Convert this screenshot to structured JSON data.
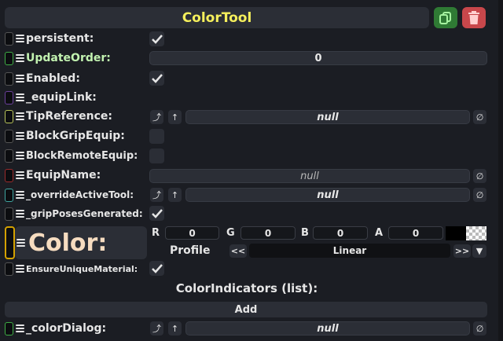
{
  "header": {
    "title": "ColorTool",
    "duplicate_icon": "duplicate-icon",
    "delete_icon": "trash-icon"
  },
  "fields": {
    "persistent": {
      "label": "persistent:"
    },
    "update_order": {
      "label": "UpdateOrder:",
      "value": "0"
    },
    "enabled": {
      "label": "Enabled:"
    },
    "equip_link": {
      "label": "_equipLink:"
    },
    "tip_reference": {
      "label": "TipReference:",
      "value": "null"
    },
    "block_grip_equip": {
      "label": "BlockGripEquip:"
    },
    "block_remote_equip": {
      "label": "BlockRemoteEquip:"
    },
    "equip_name": {
      "label": "EquipName:",
      "value": "null"
    },
    "override_active_tool": {
      "label": "_overrideActiveTool:",
      "value": "null"
    },
    "grip_poses_generated": {
      "label": "_gripPosesGenerated:"
    },
    "color": {
      "label": "Color:",
      "r_label": "R",
      "r": "0",
      "g_label": "G",
      "g": "0",
      "b_label": "B",
      "b": "0",
      "a_label": "A",
      "a": "0",
      "profile_label": "Profile",
      "profile_prev": "<<",
      "profile_value": "Linear",
      "profile_next": ">>",
      "dropdown_icon": "▼"
    },
    "ensure_unique_material": {
      "label": "EnsureUniqueMaterial:"
    },
    "color_indicators": {
      "label": "ColorIndicators (list):",
      "add_label": "Add"
    },
    "color_dialog": {
      "label": "_colorDialog:",
      "value": "null"
    }
  },
  "buttons": {
    "jump_glyph": "⤴",
    "up_glyph": "↑",
    "clear_glyph": "∅"
  },
  "colors": {
    "title": "#f5ef5c",
    "green_label": "#c2f2b0",
    "color_label": "#f6dcc0",
    "duplicate": "#2f7a34",
    "delete": "#c8474b",
    "color_slot_border": "#d4a100"
  }
}
